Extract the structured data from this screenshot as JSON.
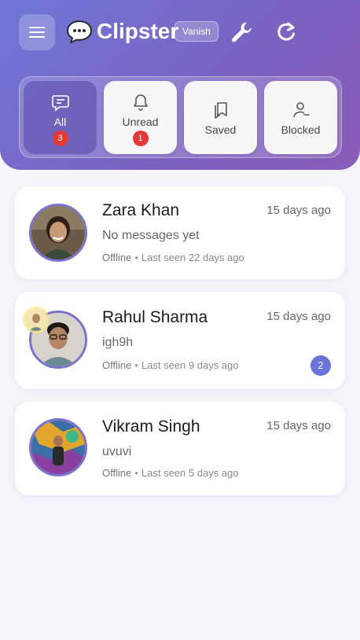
{
  "app": {
    "title": "Clipster",
    "mode_badge": "Vanish"
  },
  "header": {
    "menu_icon": "hamburger-menu-icon",
    "brand_icon": "speech-bubble-icon",
    "tool_icon": "wrench-icon",
    "refresh_icon": "refresh-icon"
  },
  "filters": [
    {
      "label": "All",
      "icon": "chat-icon",
      "badge": "3",
      "active": true
    },
    {
      "label": "Unread",
      "icon": "bell-icon",
      "badge": "1",
      "active": false
    },
    {
      "label": "Saved",
      "icon": "bookmarks-icon",
      "badge": "",
      "active": false
    },
    {
      "label": "Blocked",
      "icon": "user-blocked-icon",
      "badge": "",
      "active": false
    }
  ],
  "chats": [
    {
      "name": "Zara Khan",
      "time": "15 days ago",
      "last_message": "No messages yet",
      "status": "Offline",
      "last_seen": "Last seen 22 days ago",
      "unread": ""
    },
    {
      "name": "Rahul Sharma",
      "time": "15 days ago",
      "last_message": "igh9h",
      "status": "Offline",
      "last_seen": "Last seen 9 days ago",
      "unread": "2"
    },
    {
      "name": "Vikram Singh",
      "time": "15 days ago",
      "last_message": "uvuvi",
      "status": "Offline",
      "last_seen": "Last seen 5 days ago",
      "unread": ""
    }
  ],
  "colors": {
    "header_gradient_start": "#6f77d8",
    "header_gradient_end": "#8a5bb8",
    "accent": "#6a74d8",
    "badge_red": "#e53935"
  }
}
